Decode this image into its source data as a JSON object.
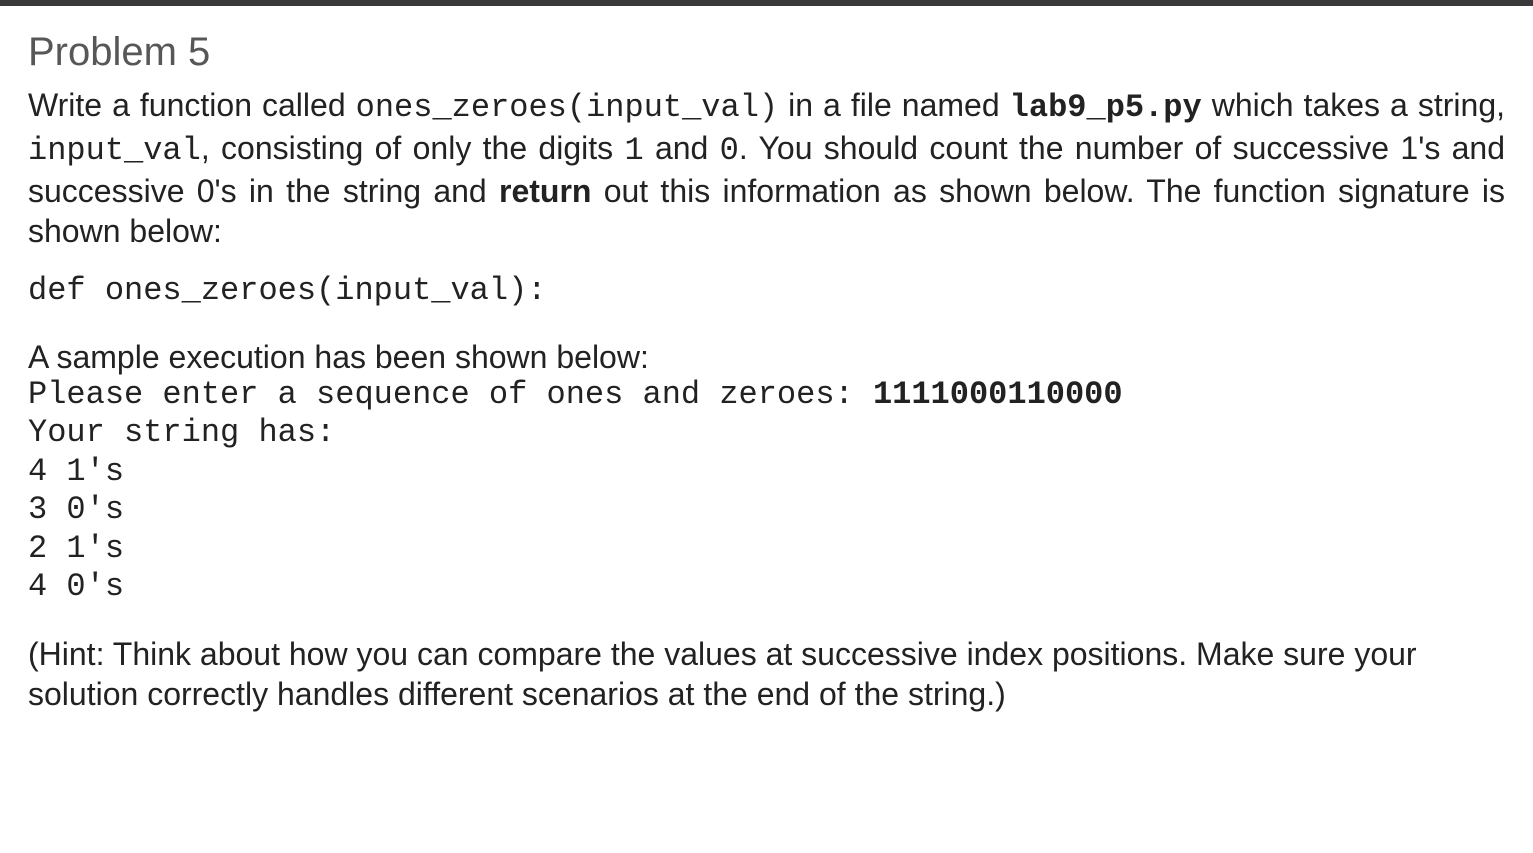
{
  "heading": "Problem 5",
  "p1": {
    "t1": "Write a function called ",
    "c1": "ones_zeroes(input_val)",
    "t2": " in a file named ",
    "c2": "lab9_p5.py",
    "t3": " which takes a string, ",
    "c3": "input_val",
    "t4": ", consisting of only the digits ",
    "c4": "1",
    "t5": "  and ",
    "c5": "0",
    "t6": ". You should count the number of successive 1's and successive 0's in the string and ",
    "b1": "return",
    "t7": " out this information as shown below. The function signature is shown below:"
  },
  "signature": "def ones_zeroes(input_val):",
  "sample_intro": "A sample execution has been shown below:",
  "sample": {
    "prompt_label": "Please enter a sequence of ones and zeroes: ",
    "prompt_input": "1111000110000",
    "line1": "Your string has:",
    "line2": "4 1's",
    "line3": "3 0's",
    "line4": "2 1's",
    "line5": "4 0's"
  },
  "hint": "(Hint: Think about how you can compare the values at successive index positions. Make sure your solution correctly handles different scenarios at the end of the string.)"
}
